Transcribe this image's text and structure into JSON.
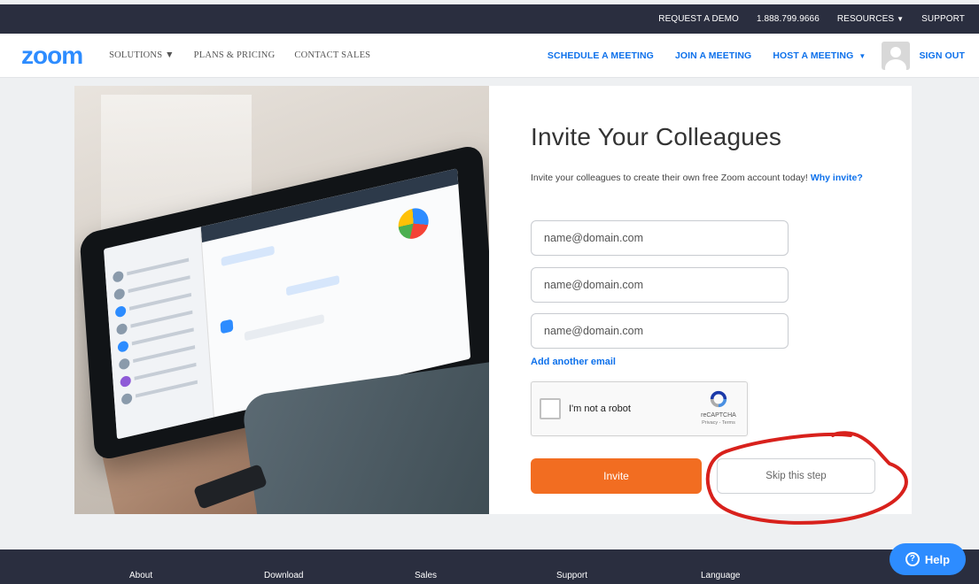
{
  "topbar": {
    "request_demo": "REQUEST A DEMO",
    "phone": "1.888.799.9666",
    "resources": "RESOURCES",
    "support": "SUPPORT"
  },
  "nav": {
    "logo": "zoom",
    "solutions": "SOLUTIONS",
    "plans_pricing": "PLANS & PRICING",
    "contact_sales": "CONTACT SALES",
    "schedule": "SCHEDULE A MEETING",
    "join": "JOIN A MEETING",
    "host": "HOST A MEETING",
    "sign_out": "SIGN OUT"
  },
  "form": {
    "title": "Invite Your Colleagues",
    "subtitle": "Invite your colleagues to create their own free Zoom account today!",
    "why_invite": "Why invite?",
    "emails": [
      {
        "placeholder": "name@domain.com",
        "value": ""
      },
      {
        "placeholder": "name@domain.com",
        "value": ""
      },
      {
        "placeholder": "name@domain.com",
        "value": ""
      }
    ],
    "add_another": "Add another email",
    "captcha": {
      "label": "I'm not a robot",
      "brand": "reCAPTCHA",
      "terms": "Privacy - Terms"
    },
    "invite_button": "Invite",
    "skip_button": "Skip this step"
  },
  "footer": {
    "about": "About",
    "download": "Download",
    "sales": "Sales",
    "support": "Support",
    "language": "Language"
  },
  "help": {
    "label": "Help",
    "icon": "?"
  },
  "colors": {
    "brand_blue": "#2d8cff",
    "link_blue": "#0e71eb",
    "invite_orange": "#f26d21",
    "dark_bar": "#2a2e3f",
    "annotation_red": "#d8211c"
  }
}
